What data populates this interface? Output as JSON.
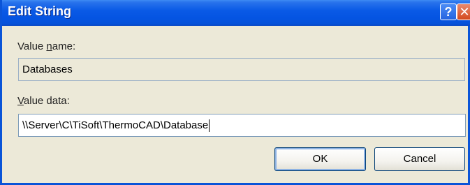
{
  "window": {
    "title": "Edit String",
    "help_glyph": "?",
    "close_glyph": "✕"
  },
  "value_name": {
    "label_prefix": "Value ",
    "label_accel": "n",
    "label_suffix": "ame:",
    "value": "Databases"
  },
  "value_data": {
    "label_accel": "V",
    "label_suffix": "alue data:",
    "value": "\\\\Server\\C\\TiSoft\\ThermoCAD\\Database"
  },
  "buttons": {
    "ok": "OK",
    "cancel": "Cancel"
  },
  "colors": {
    "titlebar": "#0554e2",
    "window_bg": "#ece9d8",
    "close_button": "#d4491d"
  }
}
